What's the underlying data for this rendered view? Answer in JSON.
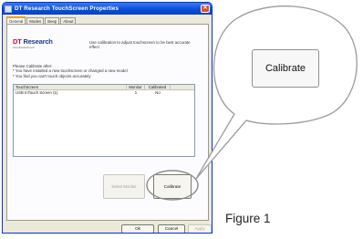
{
  "window": {
    "title": "DT Research TouchScreen Properties",
    "close_glyph": "✕"
  },
  "tabs": [
    {
      "label": "General",
      "active": true
    },
    {
      "label": "Modes",
      "active": false
    },
    {
      "label": "Beep",
      "active": false
    },
    {
      "label": "About",
      "active": false
    }
  ],
  "logo": {
    "brand_prefix": "DT",
    "brand_rest": " Research",
    "url": "www.dtresearch.com"
  },
  "intro_text": "Use calibration to adjust touchscreen to be best accurate effect.",
  "instructions": {
    "heading": "Please Calibrate after:",
    "lines": [
      "* You have installed a new touchscreen or changed a new model",
      "* You find you can't touch objects accurately"
    ]
  },
  "devices": {
    "columns": [
      "TouchScreen",
      "Monitor",
      "Calibrated"
    ],
    "rows": [
      [
        "USB InTouch Screen (1)",
        "1",
        "No"
      ]
    ]
  },
  "buttons": {
    "select_monitor": "Select Monitor",
    "calibrate": "Calibrate",
    "ok": "Ok",
    "cancel": "Cancel",
    "apply": "Apply"
  },
  "callout": {
    "zoomed_button_label": "Calibrate"
  },
  "caption": "Figure 1",
  "colors": {
    "titlebar": "#0a4ed8",
    "brand_red": "#c8102e",
    "brand_blue": "#1e3a8a"
  }
}
